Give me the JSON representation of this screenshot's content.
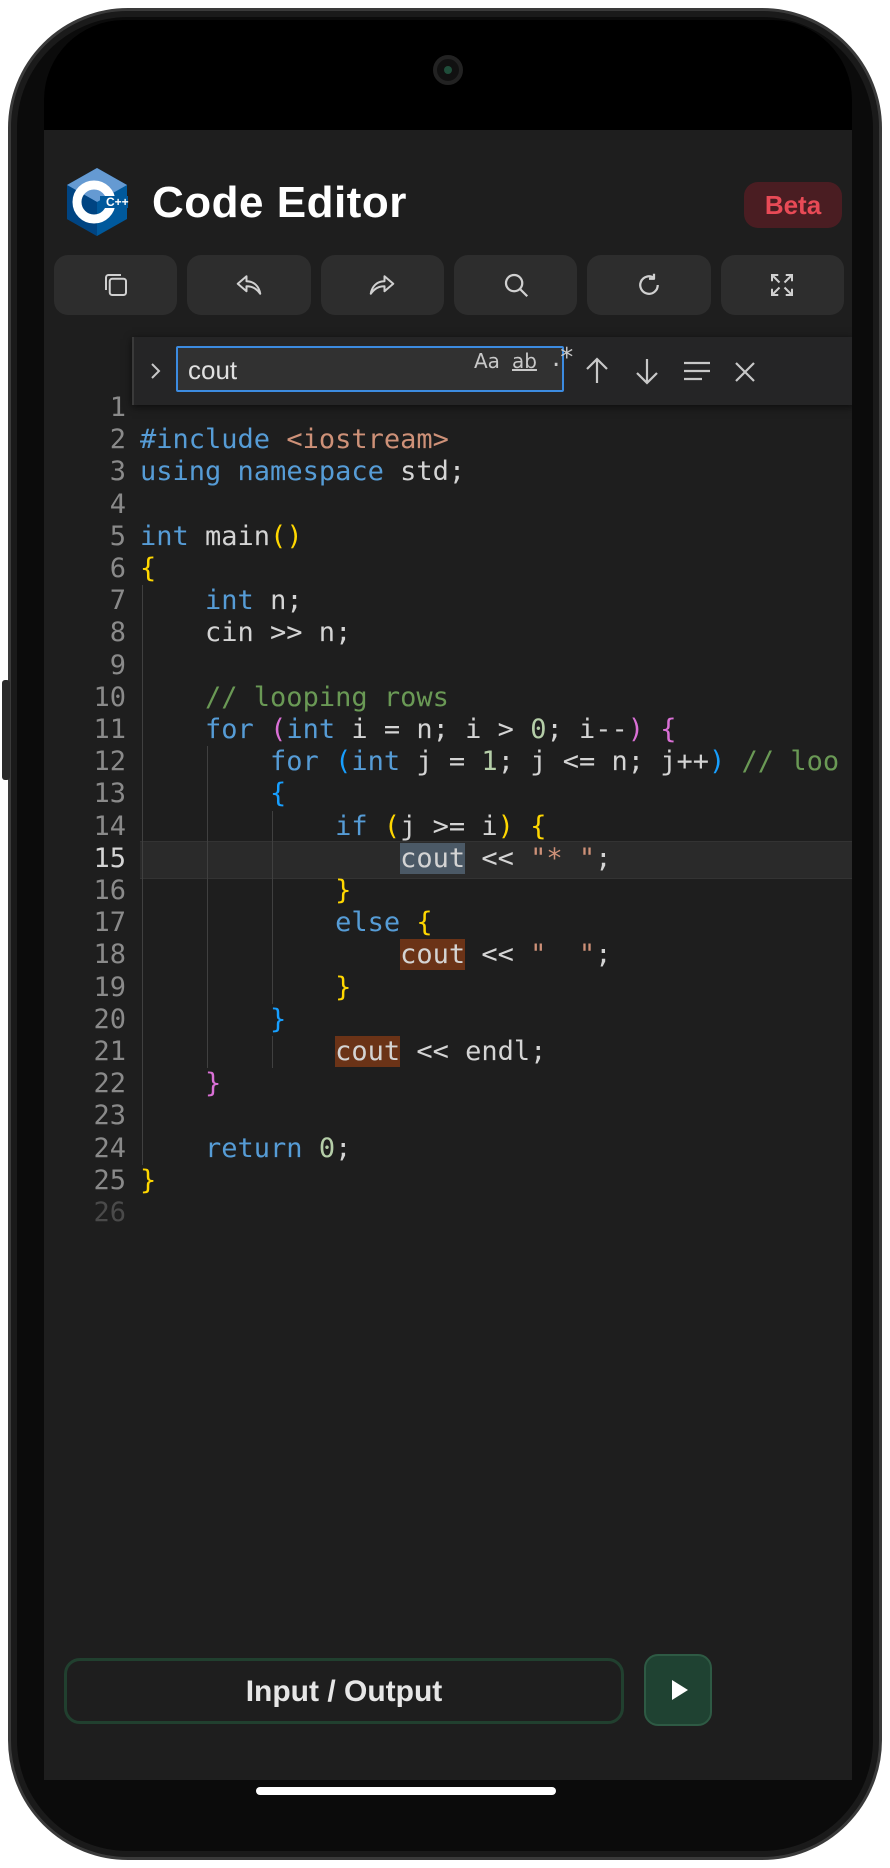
{
  "header": {
    "title": "Code Editor",
    "badge": "Beta",
    "logo_text": "C++"
  },
  "toolbar": [
    "copy-icon",
    "undo-icon",
    "redo-icon",
    "search-icon",
    "reset-icon",
    "fullscreen-icon"
  ],
  "find": {
    "query": "cout",
    "match_case_label": "Aa",
    "whole_word_label": "ab",
    "regex_label": ".*"
  },
  "code": {
    "current_line": 15,
    "line_numbers": [
      "1",
      "2",
      "3",
      "4",
      "5",
      "6",
      "7",
      "8",
      "9",
      "10",
      "11",
      "12",
      "13",
      "14",
      "15",
      "16",
      "17",
      "18",
      "19",
      "20",
      "21",
      "22",
      "23",
      "24",
      "25",
      "26"
    ],
    "lines": [
      "",
      "#include <iostream>",
      "using namespace std;",
      "",
      "int main()",
      "{",
      "    int n;",
      "    cin >> n;",
      "",
      "    // looping rows",
      "    for (int i = n; i > 0; i--) {",
      "        for (int j = 1; j <= n; j++) // loo",
      "        {",
      "            if (j >= i) {",
      "                cout << \"* \";",
      "            }",
      "            else {",
      "                cout << \"  \";",
      "            }",
      "        }",
      "            cout << endl;",
      "    }",
      "",
      "    return 0;",
      "}",
      ""
    ]
  },
  "bottom": {
    "io_label": "Input / Output",
    "run_icon": "play-icon"
  },
  "colors": {
    "background": "#1e1e1e",
    "accent": "#3c8be0",
    "badge": "#e84a56",
    "run": "#1f4232"
  }
}
